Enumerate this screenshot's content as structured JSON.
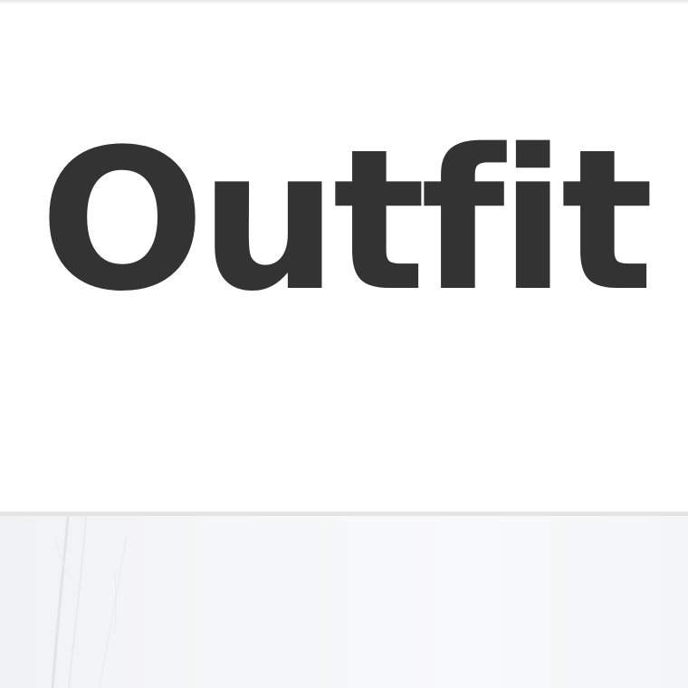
{
  "page": {
    "title": "Outfit"
  },
  "colors": {
    "text": "#333333",
    "background": "#ffffff",
    "divider": "#e4e4e4",
    "photo_tint": "#f4f5f6"
  }
}
